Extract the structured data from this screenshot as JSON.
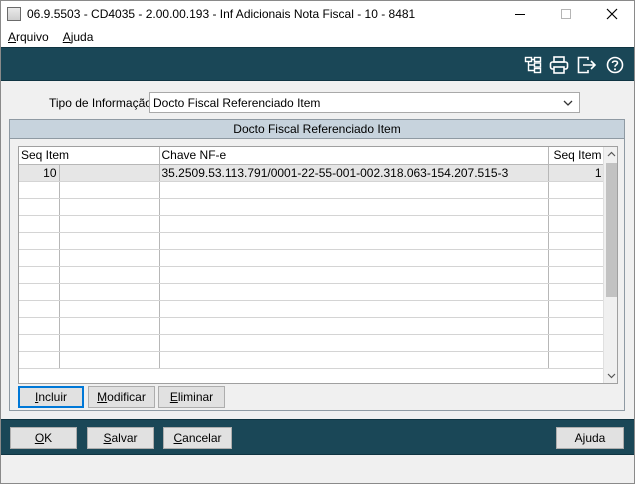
{
  "window": {
    "title": "06.9.5503 - CD4035 - 2.00.00.193 - Inf Adicionais Nota Fiscal - 10 - 8481"
  },
  "menu": {
    "items": [
      {
        "label_ul": "A",
        "label_rest": "rquivo"
      },
      {
        "label_ul": "A",
        "label_rest": "juda"
      }
    ]
  },
  "toolbar": {
    "icons": [
      "tree-icon",
      "print-icon",
      "exit-icon",
      "help-icon"
    ]
  },
  "form": {
    "tipo_label": "Tipo de Informação:",
    "tipo_value": "Docto Fiscal Referenciado Item"
  },
  "group": {
    "title": "Docto Fiscal Referenciado Item",
    "columns": [
      "Seq Item",
      "Chave NF-e",
      "Seq Item"
    ],
    "rows": [
      {
        "seq_item": "10",
        "chave_nfe": "35.2509.53.113.791/0001-22-55-001-002.318.063-154.207.515-3",
        "seq_item_ref": "1"
      }
    ],
    "buttons": {
      "incluir": {
        "ul": "I",
        "rest": "ncluir"
      },
      "modificar": {
        "ul": "M",
        "rest": "odificar"
      },
      "eliminar": {
        "ul": "E",
        "rest": "liminar"
      }
    }
  },
  "footer": {
    "ok": {
      "ul": "O",
      "rest": "K"
    },
    "salvar": {
      "ul": "S",
      "rest": "alvar"
    },
    "cancelar": {
      "ul": "C",
      "rest": "ancelar"
    },
    "ajuda": {
      "pre": "A",
      "ul": "j",
      "rest": "uda"
    }
  },
  "colors": {
    "toolbar_bg": "#1a4757",
    "group_header_bg": "#c7d3dd",
    "focus_border": "#0078d7"
  }
}
